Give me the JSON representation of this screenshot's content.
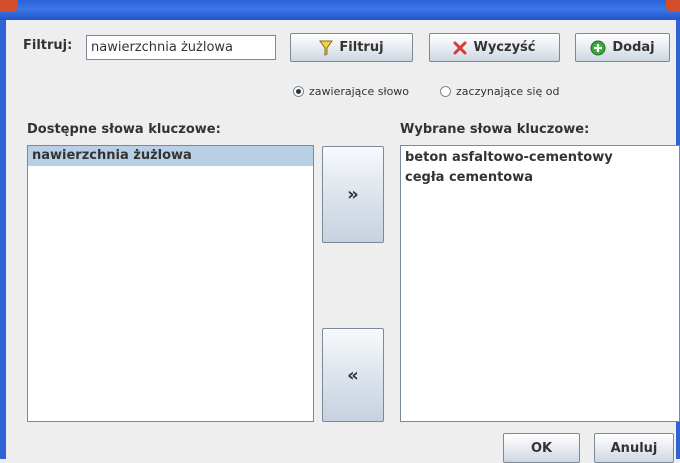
{
  "filter": {
    "label": "Filtruj:",
    "value": "nawierzchnia żużlowa"
  },
  "toolbar": {
    "filter_label": "Filtruj",
    "clear_label": "Wyczyść",
    "add_label": "Dodaj"
  },
  "match_mode": {
    "options": [
      "zawierające słowo",
      "zaczynające się od"
    ],
    "selected": "zawierające słowo"
  },
  "available": {
    "heading": "Dostępne słowa kluczowe:",
    "items": [
      "nawierzchnia żużlowa"
    ],
    "selected_index": 0
  },
  "selected": {
    "heading": "Wybrane słowa kluczowe:",
    "items": [
      "beton asfaltowo-cementowy",
      "cegła cementowa"
    ]
  },
  "transfer": {
    "add_symbol": "»",
    "remove_symbol": "«"
  },
  "dialog": {
    "ok_label": "OK",
    "cancel_label": "Anuluj"
  },
  "colors": {
    "titlebar": "#2e63d6",
    "selection": "#b8cfe5",
    "background": "#eeeeee"
  }
}
